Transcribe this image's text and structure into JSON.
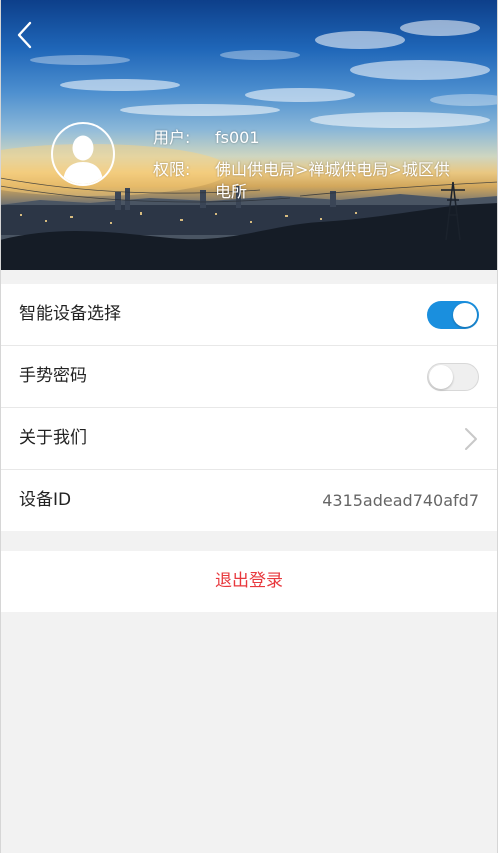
{
  "header": {
    "user_label": "用户:",
    "user_value": "fs001",
    "permission_label": "权限:",
    "permission_value": "佛山供电局>禅城供电局>城区供电所"
  },
  "settings": {
    "items": [
      {
        "label": "智能设备选择",
        "control": "toggle",
        "enabled": true
      },
      {
        "label": "手势密码",
        "control": "toggle",
        "enabled": false
      },
      {
        "label": "关于我们",
        "control": "chevron"
      },
      {
        "label": "设备ID",
        "value": "4315adead740afd7"
      }
    ]
  },
  "logout_label": "退出登录",
  "colors": {
    "toggle_on": "#1a8fde",
    "logout_text": "#e8383d",
    "background": "#f2f2f2"
  },
  "icons": {
    "back": "chevron-left-icon",
    "avatar": "user-avatar-icon",
    "about": "chevron-right-icon"
  }
}
